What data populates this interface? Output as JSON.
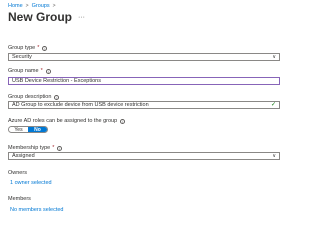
{
  "breadcrumb": {
    "home": "Home",
    "sep": ">",
    "groups": "Groups",
    "sep2": ">"
  },
  "page": {
    "title": "New Group",
    "more": "···"
  },
  "group_type": {
    "label": "Group type",
    "required": "*",
    "value": "Security"
  },
  "group_name": {
    "label": "Group name",
    "required": "*",
    "value": "USB Device Restriction - Exceptions"
  },
  "group_description": {
    "label": "Group description",
    "value": "AD Group to exclude device from USB device restriction"
  },
  "azure_roles": {
    "label": "Azure AD roles can be assigned to the group",
    "yes": "Yes",
    "no": "No",
    "selected": "No"
  },
  "membership": {
    "label": "Membership type",
    "required": "*",
    "value": "Assigned"
  },
  "owners": {
    "label": "Owners",
    "link": "1 owner selected"
  },
  "members": {
    "label": "Members",
    "link": "No members selected"
  },
  "icons": {
    "info": "i",
    "chevron": "∨",
    "check": "✓"
  },
  "colors": {
    "accent": "#0078d4",
    "focus_border": "#8764b8",
    "valid": "#107c10"
  }
}
